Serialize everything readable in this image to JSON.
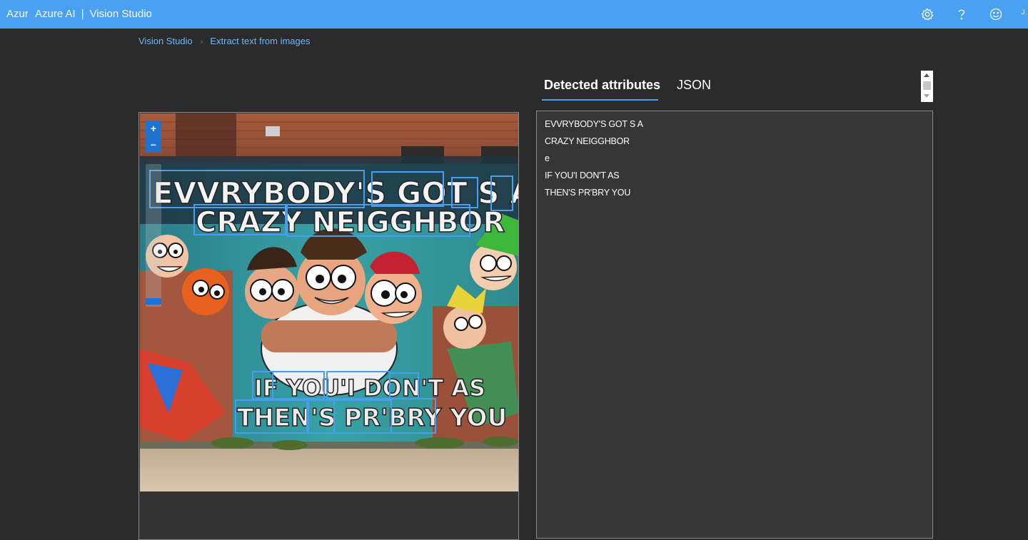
{
  "header": {
    "tab_text": "Azure AI | Vision Studio",
    "brand_left": "Azure AI",
    "brand_sep": "|",
    "brand_right": "Vision Studio",
    "user_initial": "J",
    "icons": [
      "gear-icon",
      "help-icon",
      "feedback-smiley-icon"
    ]
  },
  "breadcrumb": {
    "items": [
      "Vision Studio",
      "Extract text from images"
    ],
    "separator": "›"
  },
  "tabs": {
    "active": "Detected attributes",
    "other": "JSON"
  },
  "zoom": {
    "in_label": "+",
    "out_label": "−"
  },
  "image": {
    "mural_text": {
      "line1": "EVVRYBODY'S GOT S A",
      "line2": "CRAZY NEIGGHBOR",
      "line3": "IF YOU'I DON'T AS",
      "line4": "THEN'S PR'BRY YOU"
    }
  },
  "results": {
    "lines": [
      "EVVRYBODY'S GOT S A",
      "CRAZY NEIGGHBOR",
      "e",
      "IF YOU'I DON'T AS",
      "THEN'S PR'BRY YOU"
    ]
  },
  "colors": {
    "header_bg": "#4aa0f2",
    "page_bg": "#2b2b2b",
    "panel_bg": "#363636",
    "accent": "#1e72d2",
    "link": "#6cb8ff"
  }
}
